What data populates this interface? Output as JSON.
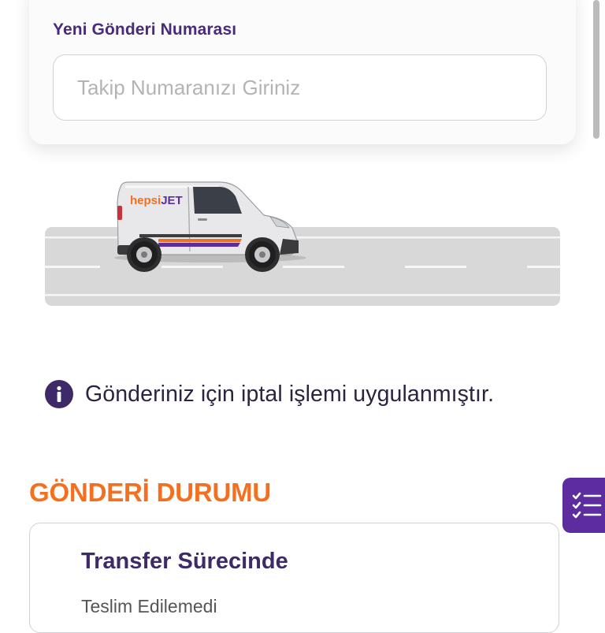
{
  "tracking": {
    "title": "Yeni Gönderi Numarası",
    "placeholder": "Takip Numaranızı Giriniz"
  },
  "illustration": {
    "brand_prefix": "hepsi",
    "brand_suffix": "JET",
    "brand_color_orange": "#f4701f",
    "brand_color_purple": "#5d2da0"
  },
  "notice": {
    "icon": "info-icon",
    "text": "Gönderiniz için iptal işlemi uygulanmıştır."
  },
  "section": {
    "title": "GÖNDERİ DURUMU"
  },
  "status": {
    "title": "Transfer Sürecinde",
    "subtitle": "Teslim Edilemedi"
  },
  "floating_button": {
    "icon": "checklist-icon"
  },
  "colors": {
    "accent_orange": "#f4701f",
    "accent_purple": "#5d2da0",
    "heading_purple": "#4a2a7a"
  }
}
